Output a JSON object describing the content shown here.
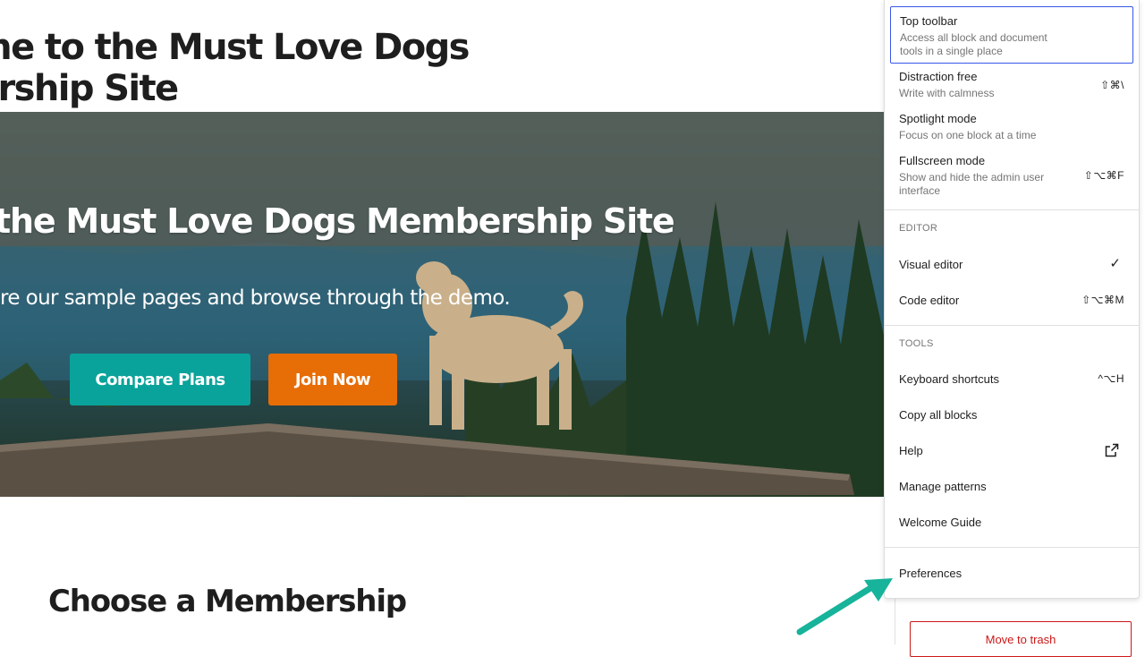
{
  "canvas": {
    "page_title": "me to the Must Love Dogs\nership Site",
    "hero": {
      "heading": "the Must Love Dogs Membership Site",
      "subtext": "re our sample pages and browse through the demo.",
      "compare_button": "Compare Plans",
      "join_button": "Join Now"
    },
    "section_heading": "Choose a Membership"
  },
  "sidebar": {
    "trash_button": "Move to trash"
  },
  "menu": {
    "view_items": [
      {
        "label": "Top toolbar",
        "description": "Access all block and document tools in a single place",
        "shortcut": ""
      },
      {
        "label": "Distraction free",
        "description": "Write with calmness",
        "shortcut": "⇧⌘\\"
      },
      {
        "label": "Spotlight mode",
        "description": "Focus on one block at a time",
        "shortcut": ""
      },
      {
        "label": "Fullscreen mode",
        "description": "Show and hide the admin user interface",
        "shortcut": "⇧⌥⌘F"
      }
    ],
    "editor_group_label": "EDITOR",
    "editor_items": [
      {
        "label": "Visual editor",
        "shortcut": ""
      },
      {
        "label": "Code editor",
        "shortcut": "⇧⌥⌘M"
      }
    ],
    "tools_group_label": "TOOLS",
    "tools_items": [
      {
        "label": "Keyboard shortcuts",
        "shortcut": "^⌥H"
      },
      {
        "label": "Copy all blocks",
        "shortcut": ""
      },
      {
        "label": "Help",
        "shortcut": ""
      },
      {
        "label": "Manage patterns",
        "shortcut": ""
      },
      {
        "label": "Welcome Guide",
        "shortcut": ""
      }
    ],
    "preferences_label": "Preferences"
  },
  "colors": {
    "accent": "#3858e9",
    "teal_button": "#0aa39b",
    "orange_button": "#e76d07",
    "trash_red": "#cc1818",
    "annotation_arrow": "#17b39a"
  },
  "icons": [
    "checkmark-icon",
    "external-link-icon",
    "annotation-arrow-icon"
  ]
}
